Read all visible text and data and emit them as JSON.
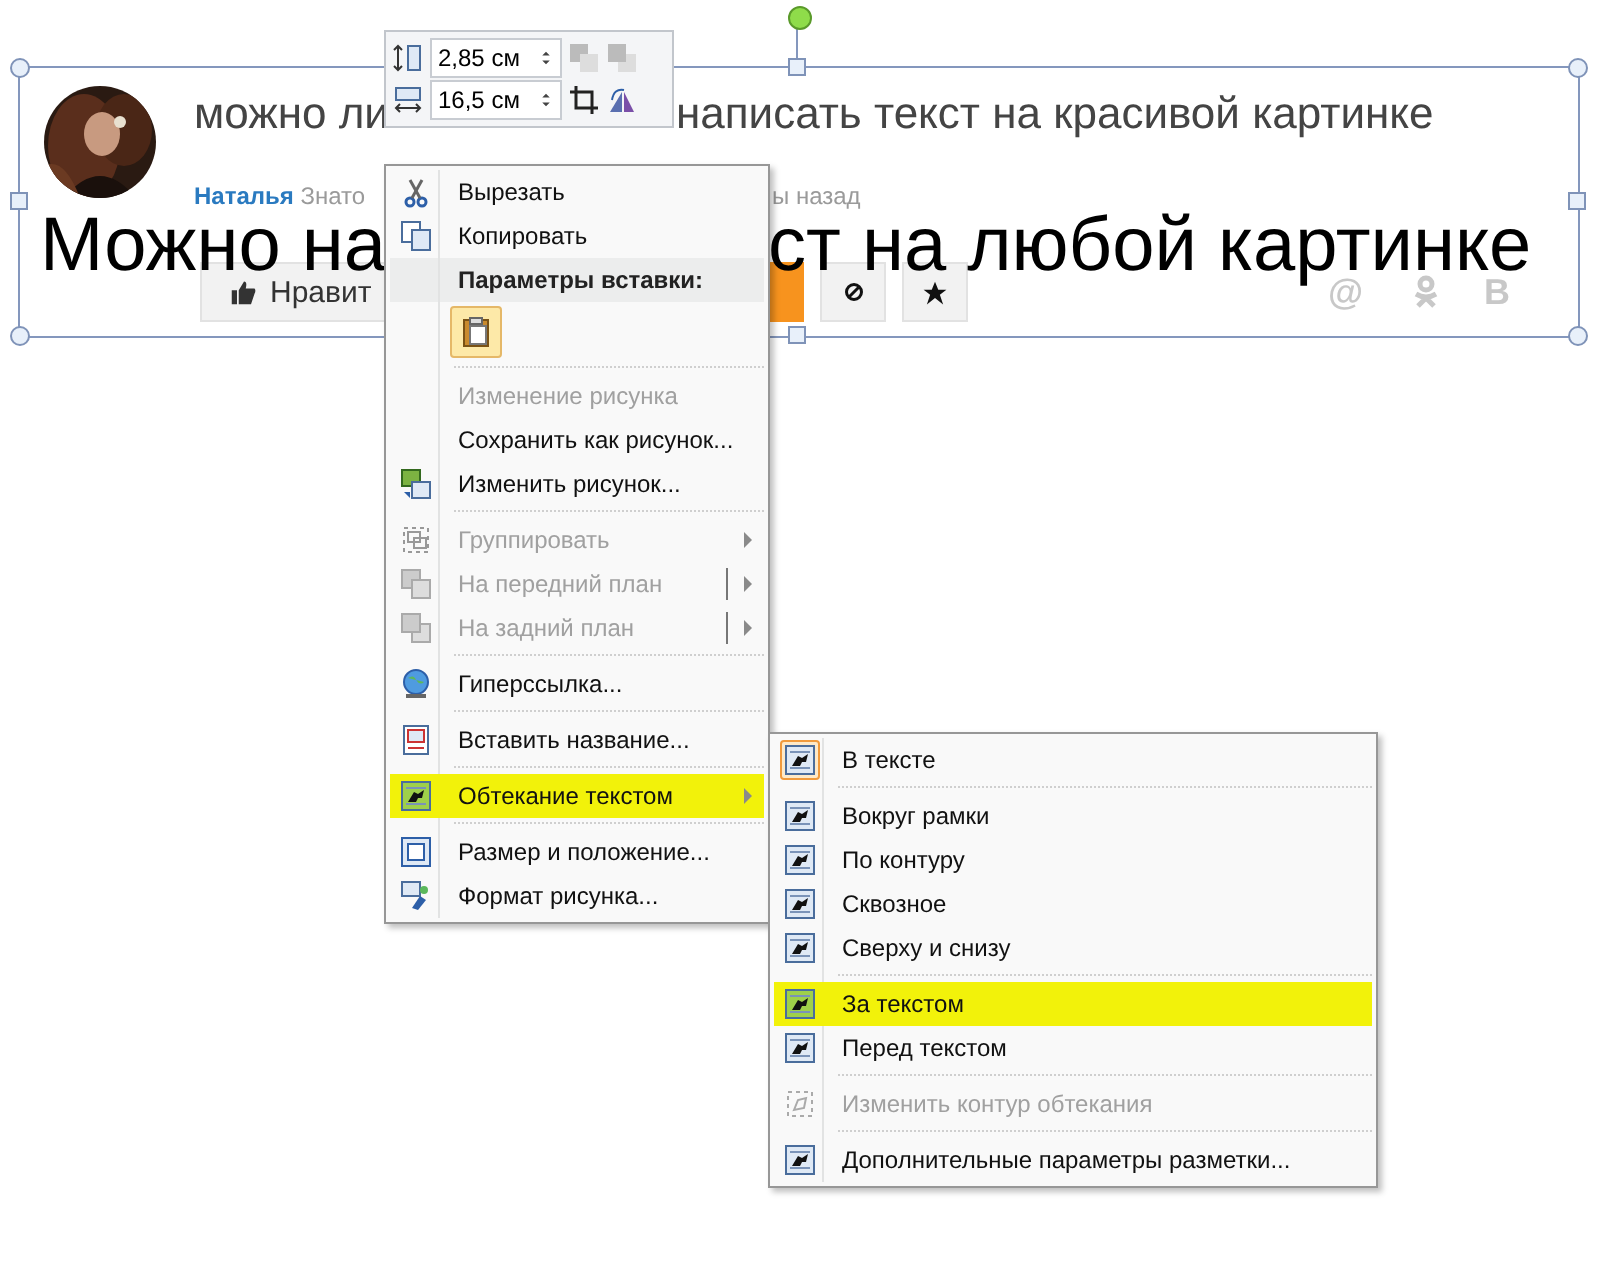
{
  "picture": {
    "title_left": "можно ли",
    "title_right": "написать текст на красивой картинке",
    "author": "Наталья",
    "meta_left": "Знато",
    "meta_right": "ы назад",
    "overlay_left": "Можно на",
    "overlay_right": "ст на любой картинке",
    "like_button": "Нравит",
    "share_icons": [
      "@",
      "В"
    ]
  },
  "size_toolbar": {
    "height": "2,85 см",
    "width": "16,5 см"
  },
  "context_menu": [
    {
      "kind": "item",
      "label": "Вырезать",
      "disabled": false,
      "highlighted": false,
      "has_submenu": false,
      "split": false
    },
    {
      "kind": "item",
      "label": "Копировать",
      "disabled": false,
      "highlighted": false,
      "has_submenu": false,
      "split": false
    },
    {
      "kind": "header",
      "label": "Параметры вставки:"
    },
    {
      "kind": "paste-options"
    },
    {
      "kind": "separator"
    },
    {
      "kind": "item",
      "label": "Изменение рисунка",
      "disabled": true,
      "highlighted": false,
      "has_submenu": false,
      "split": false
    },
    {
      "kind": "item",
      "label": "Сохранить как рисунок...",
      "disabled": false,
      "highlighted": false,
      "has_submenu": false,
      "split": false
    },
    {
      "kind": "item",
      "label": "Изменить рисунок...",
      "disabled": false,
      "highlighted": false,
      "has_submenu": false,
      "split": false
    },
    {
      "kind": "separator"
    },
    {
      "kind": "item",
      "label": "Группировать",
      "disabled": true,
      "highlighted": false,
      "has_submenu": true,
      "split": false
    },
    {
      "kind": "item",
      "label": "На передний план",
      "disabled": true,
      "highlighted": false,
      "has_submenu": true,
      "split": true
    },
    {
      "kind": "item",
      "label": "На задний план",
      "disabled": true,
      "highlighted": false,
      "has_submenu": true,
      "split": true
    },
    {
      "kind": "separator"
    },
    {
      "kind": "item",
      "label": "Гиперссылка...",
      "disabled": false,
      "highlighted": false,
      "has_submenu": false,
      "split": false
    },
    {
      "kind": "separator"
    },
    {
      "kind": "item",
      "label": "Вставить название...",
      "disabled": false,
      "highlighted": false,
      "has_submenu": false,
      "split": false
    },
    {
      "kind": "separator"
    },
    {
      "kind": "item",
      "label": "Обтекание текстом",
      "disabled": false,
      "highlighted": true,
      "has_submenu": true,
      "split": false
    },
    {
      "kind": "separator"
    },
    {
      "kind": "item",
      "label": "Размер и положение...",
      "disabled": false,
      "highlighted": false,
      "has_submenu": false,
      "split": false
    },
    {
      "kind": "item",
      "label": "Формат рисунка...",
      "disabled": false,
      "highlighted": false,
      "has_submenu": false,
      "split": false
    }
  ],
  "wrap_submenu": [
    {
      "kind": "item",
      "label": "В тексте",
      "selected": true,
      "disabled": false,
      "highlighted": false
    },
    {
      "kind": "separator"
    },
    {
      "kind": "item",
      "label": "Вокруг рамки",
      "selected": false,
      "disabled": false,
      "highlighted": false
    },
    {
      "kind": "item",
      "label": "По контуру",
      "selected": false,
      "disabled": false,
      "highlighted": false
    },
    {
      "kind": "item",
      "label": "Сквозное",
      "selected": false,
      "disabled": false,
      "highlighted": false
    },
    {
      "kind": "item",
      "label": "Сверху и снизу",
      "selected": false,
      "disabled": false,
      "highlighted": false
    },
    {
      "kind": "separator"
    },
    {
      "kind": "item",
      "label": "За текстом",
      "selected": false,
      "disabled": false,
      "highlighted": true
    },
    {
      "kind": "item",
      "label": "Перед текстом",
      "selected": false,
      "disabled": false,
      "highlighted": false
    },
    {
      "kind": "separator"
    },
    {
      "kind": "item",
      "label": "Изменить контур обтекания",
      "selected": false,
      "disabled": true,
      "highlighted": false
    },
    {
      "kind": "separator"
    },
    {
      "kind": "item",
      "label": "Дополнительные параметры разметки...",
      "selected": false,
      "disabled": false,
      "highlighted": false
    }
  ]
}
